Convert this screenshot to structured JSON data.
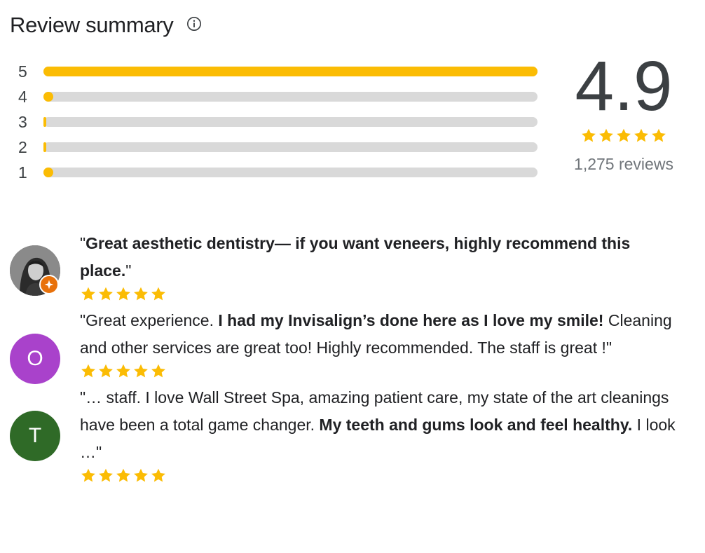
{
  "header": {
    "title": "Review summary",
    "info_icon": "info-icon"
  },
  "rating_distribution": [
    {
      "stars": "5",
      "fraction": 1.0
    },
    {
      "stars": "4",
      "fraction": 0.02
    },
    {
      "stars": "3",
      "fraction": 0.005
    },
    {
      "stars": "2",
      "fraction": 0.005
    },
    {
      "stars": "1",
      "fraction": 0.02
    }
  ],
  "summary": {
    "score": "4.9",
    "stars": 5,
    "review_count": "1,275 reviews"
  },
  "reviews": [
    {
      "avatar": {
        "type": "photo",
        "letter": "",
        "color": "#6f6f6f",
        "badge": "local-guide-badge-icon"
      },
      "segments": [
        {
          "text": "\"",
          "bold": false
        },
        {
          "text": "Great aesthetic dentistry— if you want veneers, highly recommend this place.",
          "bold": true
        },
        {
          "text": "\"",
          "bold": false
        }
      ],
      "stars": 5
    },
    {
      "avatar": {
        "type": "letter",
        "letter": "O",
        "color": "#a942cb"
      },
      "segments": [
        {
          "text": "\"Great experience. ",
          "bold": false
        },
        {
          "text": "I had my Invisalign’s done here as I love my smile!",
          "bold": true
        },
        {
          "text": " Cleaning and other services are great too! Highly recommended. The staff is great !\"",
          "bold": false
        }
      ],
      "stars": 5
    },
    {
      "avatar": {
        "type": "letter",
        "letter": "T",
        "color": "#2f6a27"
      },
      "segments": [
        {
          "text": "\"… staff. I love Wall Street Spa, amazing patient care, my state of the art cleanings have been a total game changer. ",
          "bold": false
        },
        {
          "text": "My teeth and gums look and feel healthy.",
          "bold": true
        },
        {
          "text": " I look …\"",
          "bold": false
        }
      ],
      "stars": 5
    }
  ],
  "colors": {
    "star": "#fbbc04",
    "track": "#d9d9d9",
    "text": "#202124",
    "muted": "#70757a"
  }
}
